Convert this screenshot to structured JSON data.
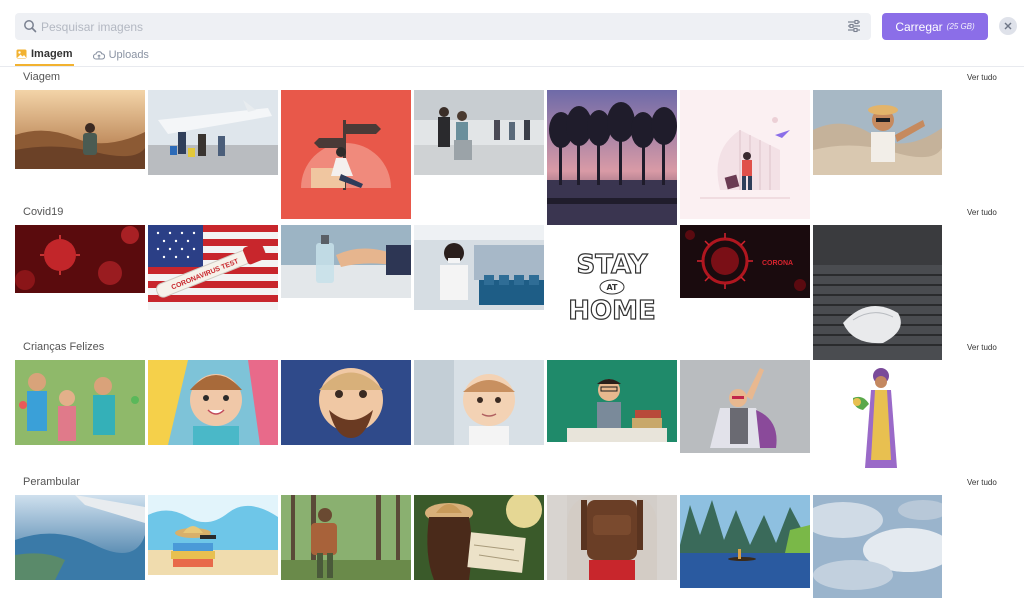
{
  "search": {
    "placeholder": "Pesquisar imagens"
  },
  "upload_button": {
    "label": "Carregar",
    "quota": "(25 GB)"
  },
  "tabs": [
    {
      "label": "Imagem",
      "icon": "image-icon",
      "active": true
    },
    {
      "label": "Uploads",
      "icon": "cloud-icon",
      "active": false
    }
  ],
  "see_all_label": "Ver tudo",
  "accent_color": "#8b6ee8",
  "tab_underline_color": "#f2b230",
  "sections": [
    {
      "title": "Viagem"
    },
    {
      "title": "Covid19"
    },
    {
      "title": "Crianças Felizes"
    },
    {
      "title": "Perambular"
    }
  ],
  "illustration_text": {
    "stay": "STAY",
    "at": "AT",
    "home": "HOME",
    "corona": "CORONA",
    "coronavirus_test": "CORONAVIRUS TEST"
  }
}
